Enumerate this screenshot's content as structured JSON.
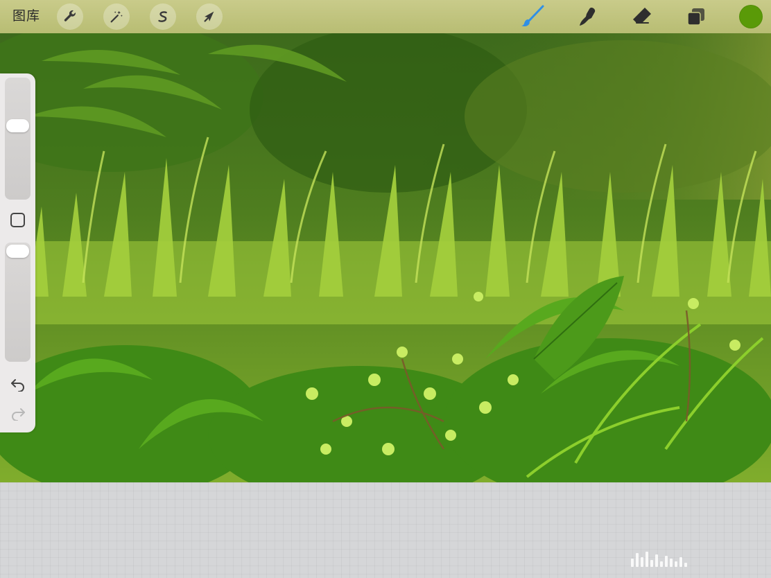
{
  "toolbar": {
    "gallery_label": "图库",
    "left_tools": [
      {
        "name": "actions",
        "icon": "wrench-icon"
      },
      {
        "name": "adjustments",
        "icon": "magic-wand-icon"
      },
      {
        "name": "selection",
        "icon": "selection-s-icon"
      },
      {
        "name": "transform",
        "icon": "arrow-cursor-icon"
      }
    ],
    "right_tools": [
      {
        "name": "paint",
        "icon": "brush-icon",
        "active": true,
        "color": "#2f8fe6"
      },
      {
        "name": "smudge",
        "icon": "smudge-finger-icon",
        "active": false
      },
      {
        "name": "eraser",
        "icon": "eraser-icon",
        "active": false
      },
      {
        "name": "layers",
        "icon": "layers-icon",
        "active": false
      }
    ],
    "current_color": "#5a9a08"
  },
  "sidebar": {
    "brush_size_level": 0.62,
    "opacity_level": 0.02,
    "modify_icon": "square-icon",
    "undo_icon": "undo-arrow-icon",
    "redo_icon": "redo-arrow-icon"
  },
  "canvas": {
    "artwork": "jungle-foliage-painting",
    "palette": [
      "#2f5e14",
      "#4f8a1c",
      "#7fb32a",
      "#a9d23a",
      "#c9e65a",
      "#7a5a2a"
    ]
  }
}
